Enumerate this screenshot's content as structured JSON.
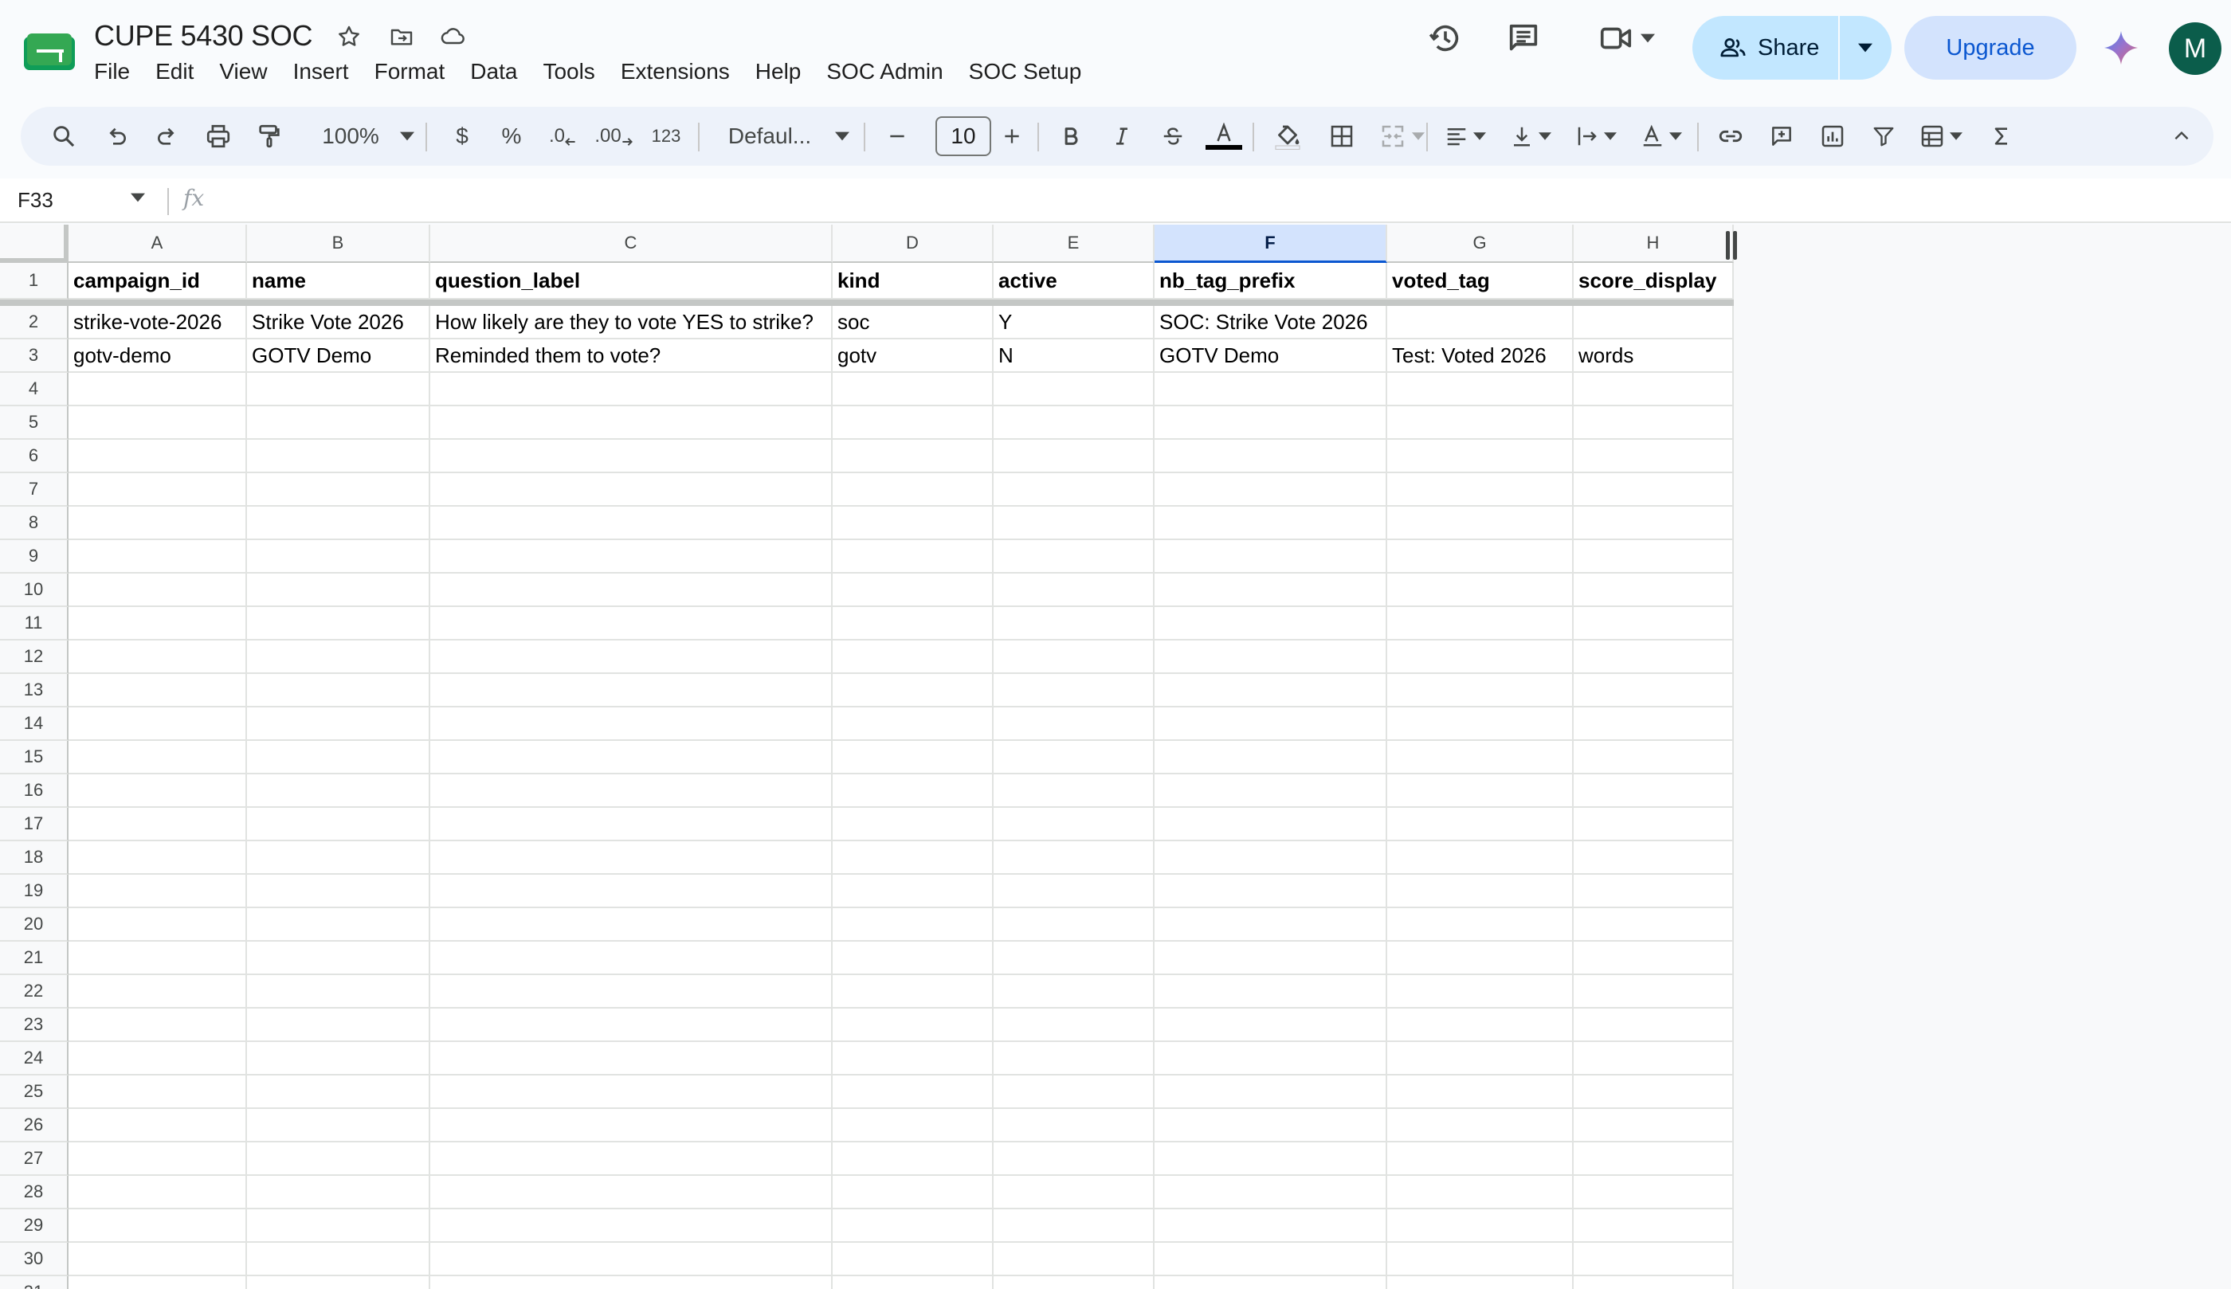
{
  "app": {
    "title": "CUPE 5430 SOC",
    "menu": [
      "File",
      "Edit",
      "View",
      "Insert",
      "Format",
      "Data",
      "Tools",
      "Extensions",
      "Help",
      "SOC Admin",
      "SOC Setup"
    ],
    "share_label": "Share",
    "upgrade_label": "Upgrade",
    "avatar_initial": "M",
    "colors": {
      "share_bg": "#c2e7ff",
      "upgrade_bg": "#d3e3fd",
      "avatar_bg": "#0b5d4b",
      "sheets_green": "#0f9d58"
    }
  },
  "toolbar": {
    "zoom": "100%",
    "currency": "$",
    "percent": "%",
    "dec_decrease": ".0",
    "dec_increase": ".00",
    "number_format": "123",
    "font": "Defaul...",
    "font_size": "10"
  },
  "formula_bar": {
    "cell_ref": "F33",
    "fx": "fx",
    "value": ""
  },
  "sheet": {
    "columns": [
      "A",
      "B",
      "C",
      "D",
      "E",
      "F",
      "G",
      "H"
    ],
    "selected_column": "F",
    "row_numbers": [
      "1",
      "2",
      "3",
      "4",
      "5",
      "6",
      "7",
      "8",
      "9",
      "10",
      "11",
      "12",
      "13",
      "14",
      "15",
      "16",
      "17",
      "18",
      "19",
      "20",
      "21",
      "22",
      "23",
      "24",
      "25",
      "26",
      "27",
      "28",
      "29",
      "30",
      "31"
    ],
    "rows": [
      [
        "campaign_id",
        "name",
        "question_label",
        "kind",
        "active",
        "nb_tag_prefix",
        "voted_tag",
        "score_display"
      ],
      [
        "strike-vote-2026",
        "Strike Vote 2026",
        "How likely are they to vote YES to strike?",
        "soc",
        "Y",
        "SOC: Strike Vote 2026",
        "",
        ""
      ],
      [
        "gotv-demo",
        "GOTV Demo",
        "Reminded them to vote?",
        "gotv",
        "N",
        "GOTV Demo",
        "Test: Voted 2026",
        "words"
      ]
    ]
  }
}
